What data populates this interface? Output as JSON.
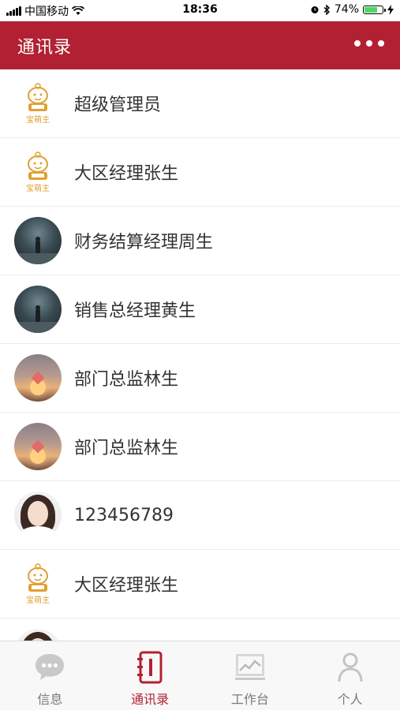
{
  "status_bar": {
    "carrier": "中国移动",
    "time": "18:36",
    "battery": "74%",
    "battery_level": 0.74
  },
  "header": {
    "title": "通讯录",
    "more_icon": "more-dots-icon"
  },
  "contacts": [
    {
      "name": "超级管理员",
      "avatar": "mascot",
      "avatar_text": "宝萌主"
    },
    {
      "name": "大区经理张生",
      "avatar": "mascot",
      "avatar_text": "宝萌主"
    },
    {
      "name": "财务结算经理周生",
      "avatar": "dark-figure"
    },
    {
      "name": "销售总经理黄生",
      "avatar": "dark-figure"
    },
    {
      "name": "部门总监林生",
      "avatar": "sunset"
    },
    {
      "name": "部门总监林生",
      "avatar": "sunset"
    },
    {
      "name": "123456789",
      "avatar": "woman-portrait"
    },
    {
      "name": "大区经理张生",
      "avatar": "mascot",
      "avatar_text": "宝萌主"
    }
  ],
  "tabbar": {
    "items": [
      {
        "label": "信息",
        "icon": "chat-bubble-icon",
        "active": false
      },
      {
        "label": "通讯录",
        "icon": "address-book-icon",
        "active": true
      },
      {
        "label": "工作台",
        "icon": "workbench-chart-icon",
        "active": false
      },
      {
        "label": "个人",
        "icon": "person-icon",
        "active": false
      }
    ]
  },
  "colors": {
    "brand": "#b22133",
    "tab_inactive": "#7a7a7a",
    "mascot": "#e0a030"
  }
}
